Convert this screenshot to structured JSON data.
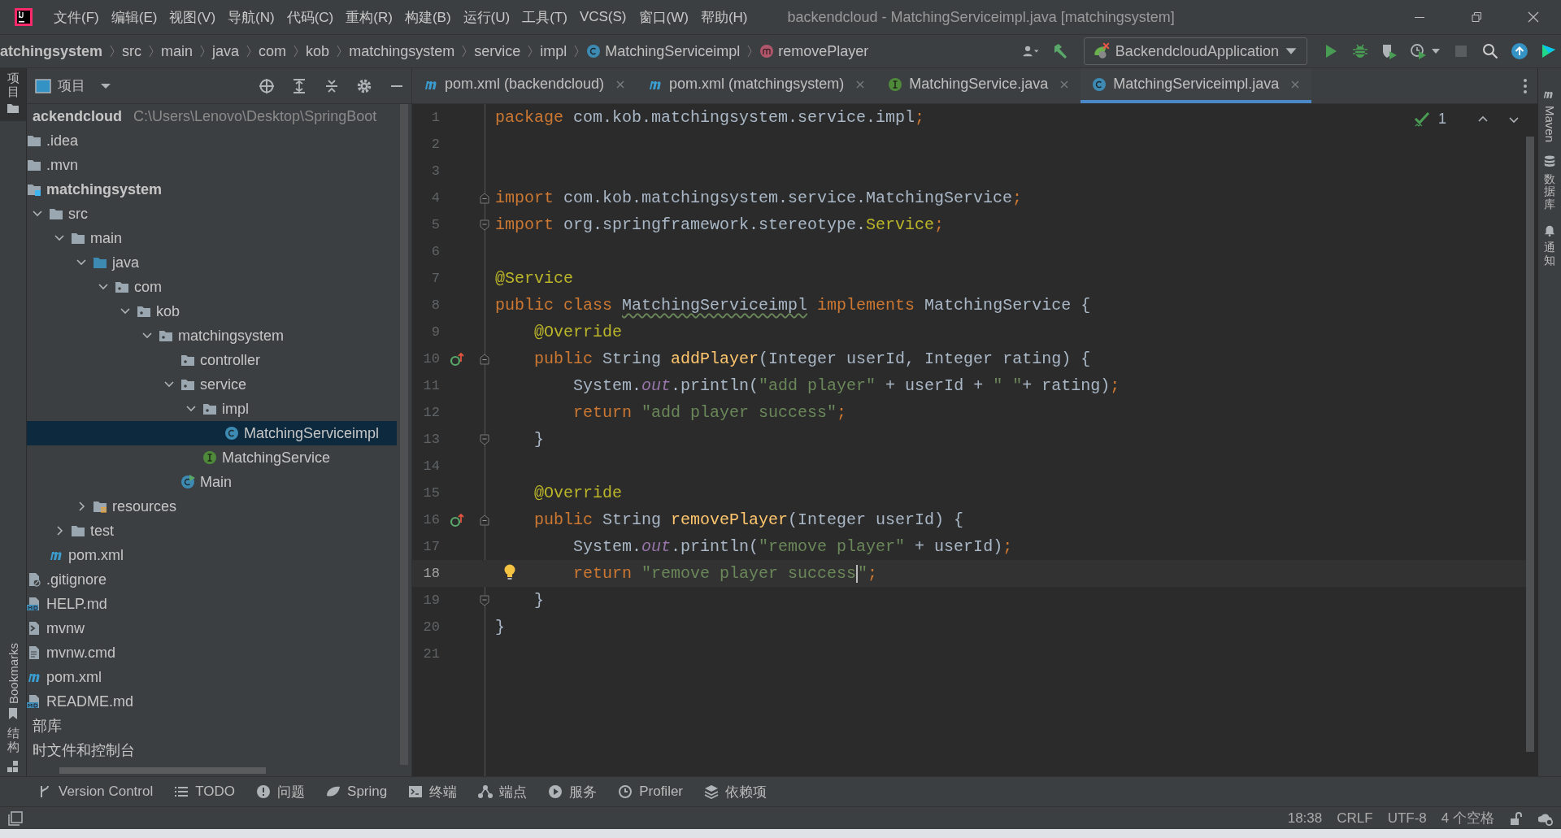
{
  "window": {
    "title": "backendcloud - MatchingServiceimpl.java [matchingsystem]"
  },
  "menu": [
    "文件(F)",
    "编辑(E)",
    "视图(V)",
    "导航(N)",
    "代码(C)",
    "重构(R)",
    "构建(B)",
    "运行(U)",
    "工具(T)",
    "VCS(S)",
    "窗口(W)",
    "帮助(H)"
  ],
  "breadcrumbs": [
    {
      "label": "atchingsystem",
      "kind": "module"
    },
    {
      "label": "src",
      "kind": "folder"
    },
    {
      "label": "main",
      "kind": "folder"
    },
    {
      "label": "java",
      "kind": "folder"
    },
    {
      "label": "com",
      "kind": "folder"
    },
    {
      "label": "kob",
      "kind": "folder"
    },
    {
      "label": "matchingsystem",
      "kind": "folder"
    },
    {
      "label": "service",
      "kind": "folder"
    },
    {
      "label": "impl",
      "kind": "folder"
    },
    {
      "label": "MatchingServiceimpl",
      "kind": "class"
    },
    {
      "label": "removePlayer",
      "kind": "method"
    }
  ],
  "run_configuration": {
    "label": "BackendcloudApplication"
  },
  "project_panel": {
    "title": "项目"
  },
  "project_tree": [
    {
      "label": "ackendcloud",
      "kind": "root",
      "hint": "C:\\Users\\Lenovo\\Desktop\\SpringBoot",
      "selected": false,
      "expanded": true,
      "children": [
        {
          "label": ".idea",
          "kind": "folder",
          "selected": false
        },
        {
          "label": ".mvn",
          "kind": "folder",
          "selected": false
        },
        {
          "label": "matchingsystem",
          "kind": "module",
          "selected": false,
          "expanded": true,
          "children": [
            {
              "label": "src",
              "kind": "folder",
              "selected": false,
              "expanded": true,
              "children": [
                {
                  "label": "main",
                  "kind": "folder",
                  "selected": false,
                  "expanded": true,
                  "children": [
                    {
                      "label": "java",
                      "kind": "source",
                      "selected": false,
                      "expanded": true,
                      "children": [
                        {
                          "label": "com",
                          "kind": "package",
                          "selected": false,
                          "expanded": true,
                          "children": [
                            {
                              "label": "kob",
                              "kind": "package",
                              "selected": false,
                              "expanded": true,
                              "children": [
                                {
                                  "label": "matchingsystem",
                                  "kind": "package",
                                  "selected": false,
                                  "expanded": true,
                                  "children": [
                                    {
                                      "label": "controller",
                                      "kind": "package",
                                      "selected": false
                                    },
                                    {
                                      "label": "service",
                                      "kind": "package",
                                      "selected": false,
                                      "expanded": true,
                                      "children": [
                                        {
                                          "label": "impl",
                                          "kind": "package",
                                          "selected": false,
                                          "expanded": true,
                                          "children": [
                                            {
                                              "label": "MatchingServiceimpl",
                                              "kind": "class",
                                              "selected": true
                                            }
                                          ]
                                        },
                                        {
                                          "label": "MatchingService",
                                          "kind": "interface",
                                          "selected": false
                                        }
                                      ]
                                    },
                                    {
                                      "label": "Main",
                                      "kind": "main-class",
                                      "selected": false
                                    }
                                  ]
                                }
                              ]
                            }
                          ]
                        }
                      ]
                    },
                    {
                      "label": "resources",
                      "kind": "resources",
                      "selected": false,
                      "expanded": false
                    }
                  ]
                },
                {
                  "label": "test",
                  "kind": "folder",
                  "selected": false,
                  "expanded": false
                }
              ]
            },
            {
              "label": "pom.xml",
              "kind": "maven",
              "selected": false
            }
          ]
        },
        {
          "label": ".gitignore",
          "kind": "ignore",
          "selected": false
        },
        {
          "label": "HELP.md",
          "kind": "markdown",
          "selected": false
        },
        {
          "label": "mvnw",
          "kind": "script",
          "selected": false
        },
        {
          "label": "mvnw.cmd",
          "kind": "text",
          "selected": false
        },
        {
          "label": "pom.xml",
          "kind": "maven",
          "selected": false
        },
        {
          "label": "README.md",
          "kind": "markdown",
          "selected": false
        }
      ]
    },
    {
      "label": "部库",
      "kind": "root",
      "selected": false
    },
    {
      "label": "时文件和控制台",
      "kind": "root",
      "selected": false
    }
  ],
  "editor_tabs": [
    {
      "label": "pom.xml (backendcloud)",
      "kind": "maven",
      "selected": false
    },
    {
      "label": "pom.xml (matchingsystem)",
      "kind": "maven",
      "selected": false
    },
    {
      "label": "MatchingService.java",
      "kind": "interface",
      "selected": false
    },
    {
      "label": "MatchingServiceimpl.java",
      "kind": "class",
      "selected": true
    }
  ],
  "inspection": {
    "count": "1"
  },
  "code_lines": [
    {
      "number": "1",
      "current": false,
      "tokens": [
        {
          "text": "package",
          "kind": "keyword"
        },
        {
          "text": " com.kob.matchingsystem.service.impl",
          "kind": "plain"
        },
        {
          "text": ";",
          "kind": "keyword"
        }
      ]
    },
    {
      "number": "2",
      "current": false
    },
    {
      "number": "3",
      "current": false
    },
    {
      "number": "4",
      "current": false,
      "gutter": [
        {
          "kind": "fold-start"
        }
      ],
      "tokens": [
        {
          "text": "import",
          "kind": "keyword"
        },
        {
          "text": " com.kob.matchingsystem.service.MatchingService",
          "kind": "plain"
        },
        {
          "text": ";",
          "kind": "keyword"
        }
      ]
    },
    {
      "number": "5",
      "current": false,
      "gutter": [
        {
          "kind": "fold-end"
        }
      ],
      "tokens": [
        {
          "text": "import",
          "kind": "keyword"
        },
        {
          "text": " org.springframework.stereotype.",
          "kind": "plain"
        },
        {
          "text": "Service",
          "kind": "annotation"
        },
        {
          "text": ";",
          "kind": "keyword"
        }
      ]
    },
    {
      "number": "6",
      "current": false
    },
    {
      "number": "7",
      "current": false,
      "tokens": [
        {
          "text": "@Service",
          "kind": "annotation"
        }
      ]
    },
    {
      "number": "8",
      "current": false,
      "tokens": [
        {
          "text": "public class ",
          "kind": "keyword"
        },
        {
          "text": "MatchingServiceimpl",
          "kind": "typo"
        },
        {
          "text": " implements",
          "kind": "keyword"
        },
        {
          "text": " MatchingService {",
          "kind": "plain"
        }
      ]
    },
    {
      "number": "9",
      "current": false,
      "tokens": [
        {
          "text": "    @Override",
          "kind": "annotation"
        }
      ]
    },
    {
      "number": "10",
      "current": false,
      "gutter": [
        {
          "kind": "override"
        },
        {
          "kind": "fold-start"
        }
      ],
      "tokens": [
        {
          "text": "    public",
          "kind": "keyword"
        },
        {
          "text": " String ",
          "kind": "plain"
        },
        {
          "text": "addPlayer",
          "kind": "method"
        },
        {
          "text": "(Integer userId, Integer rating) {",
          "kind": "plain"
        }
      ]
    },
    {
      "number": "11",
      "current": false,
      "tokens": [
        {
          "text": "        System.",
          "kind": "plain"
        },
        {
          "text": "out",
          "kind": "field"
        },
        {
          "text": ".println(",
          "kind": "plain"
        },
        {
          "text": "\"add player\"",
          "kind": "string"
        },
        {
          "text": " + userId + ",
          "kind": "plain"
        },
        {
          "text": "\" \"",
          "kind": "string"
        },
        {
          "text": "+ rating)",
          "kind": "plain"
        },
        {
          "text": ";",
          "kind": "keyword"
        }
      ]
    },
    {
      "number": "12",
      "current": false,
      "tokens": [
        {
          "text": "        return ",
          "kind": "keyword"
        },
        {
          "text": "\"add player success\"",
          "kind": "string"
        },
        {
          "text": ";",
          "kind": "keyword"
        }
      ]
    },
    {
      "number": "13",
      "current": false,
      "gutter": [
        {
          "kind": "fold-end"
        }
      ],
      "tokens": [
        {
          "text": "    }",
          "kind": "plain"
        }
      ]
    },
    {
      "number": "14",
      "current": false
    },
    {
      "number": "15",
      "current": false,
      "tokens": [
        {
          "text": "    @Override",
          "kind": "annotation"
        }
      ]
    },
    {
      "number": "16",
      "current": false,
      "gutter": [
        {
          "kind": "override"
        },
        {
          "kind": "fold-start"
        }
      ],
      "tokens": [
        {
          "text": "    public",
          "kind": "keyword"
        },
        {
          "text": " String ",
          "kind": "plain"
        },
        {
          "text": "removePlayer",
          "kind": "method"
        },
        {
          "text": "(Integer userId) {",
          "kind": "plain"
        }
      ]
    },
    {
      "number": "17",
      "current": false,
      "tokens": [
        {
          "text": "        System.",
          "kind": "plain"
        },
        {
          "text": "out",
          "kind": "field"
        },
        {
          "text": ".println(",
          "kind": "plain"
        },
        {
          "text": "\"remove player\"",
          "kind": "string"
        },
        {
          "text": " + userId)",
          "kind": "plain"
        },
        {
          "text": ";",
          "kind": "keyword"
        }
      ]
    },
    {
      "number": "18",
      "current": true,
      "gutter": [
        {
          "kind": "bulb"
        }
      ],
      "tokens": [
        {
          "text": "        return ",
          "kind": "keyword"
        },
        {
          "text": "\"remove player success",
          "kind": "string"
        },
        {
          "kind": "caret"
        },
        {
          "text": "\"",
          "kind": "string"
        },
        {
          "text": ";",
          "kind": "keyword"
        }
      ]
    },
    {
      "number": "19",
      "current": false,
      "gutter": [
        {
          "kind": "fold-end"
        }
      ],
      "tokens": [
        {
          "text": "    }",
          "kind": "plain"
        }
      ]
    },
    {
      "number": "20",
      "current": false,
      "tokens": [
        {
          "text": "}",
          "kind": "plain"
        }
      ]
    },
    {
      "number": "21",
      "current": false
    }
  ],
  "left_tool_tabs": {
    "project": "项目",
    "bookmarks": "Bookmarks",
    "structure": "结构"
  },
  "right_tool_tabs": {
    "maven": "Maven",
    "database": "数据库",
    "notifications": "通知"
  },
  "bottom_tools": [
    {
      "label": "Version Control",
      "kind": "vcs"
    },
    {
      "label": "TODO",
      "kind": "todo"
    },
    {
      "label": "问题",
      "kind": "problems"
    },
    {
      "label": "Spring",
      "kind": "spring"
    },
    {
      "label": "终端",
      "kind": "terminal"
    },
    {
      "label": "端点",
      "kind": "endpoints"
    },
    {
      "label": "服务",
      "kind": "services"
    },
    {
      "label": "Profiler",
      "kind": "profiler"
    },
    {
      "label": "依赖项",
      "kind": "dependencies"
    }
  ],
  "status_bar": {
    "position": "18:38",
    "line_separator": "CRLF",
    "encoding": "UTF-8",
    "indent": "4 个空格"
  }
}
